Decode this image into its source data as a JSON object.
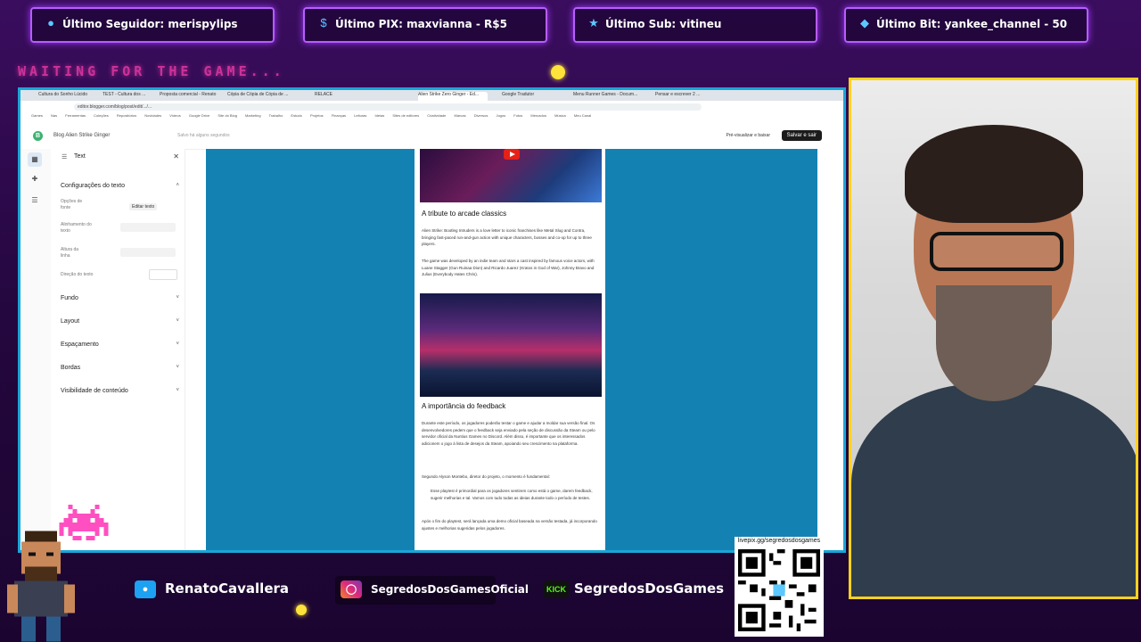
{
  "overlay": {
    "top_bars": [
      {
        "icon": "user-icon",
        "text": "Último Seguidor: merispylips"
      },
      {
        "icon": "pix-icon",
        "text": "Último PIX: maxvianna - R$5"
      },
      {
        "icon": "star-icon",
        "text": "Último Sub: vitineu"
      },
      {
        "icon": "diamond-icon",
        "text": "Último Bit: yankee_channel - 50"
      }
    ],
    "waiting_text": "WAITING FOR THE GAME...",
    "socials": [
      {
        "icon": "twitter-icon",
        "text": "RenatoCavallera",
        "color": "#1da1f2"
      },
      {
        "icon": "instagram-icon",
        "text": "SegredosDosGamesOficial",
        "color": "#c13584"
      },
      {
        "icon": "kick-icon",
        "text": "SegredosDosGames",
        "color": "#53fc18",
        "badge": "KICK"
      }
    ],
    "qr_url": "livepix.gg/segredosdosgames",
    "colors": {
      "accent": "#b85cff",
      "frame": "#ffd21f",
      "browser_border": "#1aa6d8",
      "canvas": "#1382b3"
    }
  },
  "browser": {
    "tabs": [
      "Cultura do Sonho Lúcido",
      "TEST - Cultura dos ...",
      "Proposta comercial - Renato",
      "Cópia de Cópia de Cópia de ...",
      "RELACE",
      "Alien Strike Zero Ginger - Ed...",
      "Google Tradutor",
      "Menu Runner Games - Docum...",
      "Pensar e escrever 2 ..."
    ],
    "url": "editor.blogger.com/blog/post/edit/.../...",
    "bookmarks": [
      "Games",
      "Nas",
      "Ferramentas",
      "Coleções",
      "Repositórios",
      "Novidades",
      "Vídeos",
      "Google Drive",
      "Site do Blog",
      "Marketing",
      "Trabalho",
      "Estudo",
      "Projetos",
      "Finanças",
      "Leituras",
      "Ideias",
      "Sites de editores",
      "Criatividade",
      "Marcas",
      "Diversos",
      "Jogos",
      "Fotos",
      "Mercados",
      "Música",
      "Meu Canal"
    ]
  },
  "editor": {
    "doc_title": "Blog Alien Strike Ginger",
    "autosave": "Salvo há alguns segundos",
    "preview_label": "Pré-visualizar e baixar",
    "save_label": "Salvar e sair",
    "panel": {
      "title": "Text",
      "section": "Configurações do texto",
      "sub_labels": [
        "Opções de fonte",
        "Alinhamento do texto",
        "Altura da linha",
        "Direção do texto"
      ],
      "edit_button": "Editar texto",
      "accordions": [
        "Fundo",
        "Layout",
        "Espaçamento",
        "Bordas",
        "Visibilidade de conteúdo"
      ]
    },
    "article": {
      "heading1": "A tribute to arcade classics",
      "para1": "Alien Strike: Bootleg Intruders is a love letter to iconic franchises like Metal Slug and Contra, bringing fast-paced run-and-gun action with unique characters, bosses and co-op for up to three players.",
      "para2": "The game was developed by an indie team and stars a cast inspired by famous voice actors, with Luane Stagger (Gun Ruinaa Dion) and Ricardo Juarez (Kratos in God of War), Johnny Bravo and Julius (Everybody Hates Chris).",
      "heading2": "A importância do feedback",
      "para3": "Durante este período, os jogadores poderão testar o game e ajudar a moldar sua versão final. Os desenvolvedores pedem que o feedback seja enviado pela seção de discussão da Steam ou pelo servidor oficial da Nuntius Games no Discord. Além disso, é importante que os interessados adicionem o jogo à lista de desejos da Steam, apoiando seu crescimento na plataforma.",
      "para4": "Segundo Alyson Montebo, diretor do projeto, o momento é fundamental:",
      "quote": "Esse playtest é primordial para os jogadores sentirem como está o game, darem feedback, sugerir melhorias e tal. Vamos com tudo todas as ideias durante todo o período de testes.",
      "para5": "Após o fim do playtest, será lançada uma demo oficial baseada na versão testada, já incorporando ajustes e melhorias sugeridas pelos jogadores."
    }
  }
}
